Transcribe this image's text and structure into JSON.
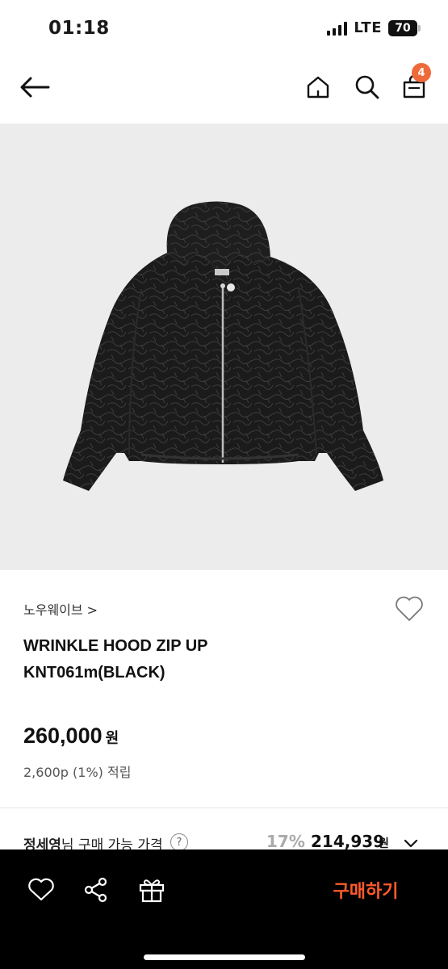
{
  "status_bar": {
    "time": "01:18",
    "network": "LTE",
    "battery": "70"
  },
  "nav": {
    "cart_badge": "4"
  },
  "product": {
    "brand": "노우웨이브 >",
    "name_line1": "WRINKLE HOOD ZIP UP",
    "name_line2": "KNT061m(BLACK)",
    "price": "260,000",
    "price_unit": "원",
    "points": "2,600p (1%) 적립"
  },
  "member_price": {
    "name": "정세영",
    "label_suffix": "님 구매 가능 가격",
    "help": "?",
    "discount": "17%",
    "price": "214,939",
    "unit": "원"
  },
  "bottom_bar": {
    "buy_label": "구매하기"
  },
  "colors": {
    "accent": "#ff5a2c",
    "badge": "#ef6a3a",
    "image_bg": "#ececec"
  },
  "icons": [
    "back-arrow-icon",
    "home-icon",
    "search-icon",
    "cart-icon",
    "heart-icon",
    "share-icon",
    "gift-icon",
    "chevron-down-icon"
  ]
}
